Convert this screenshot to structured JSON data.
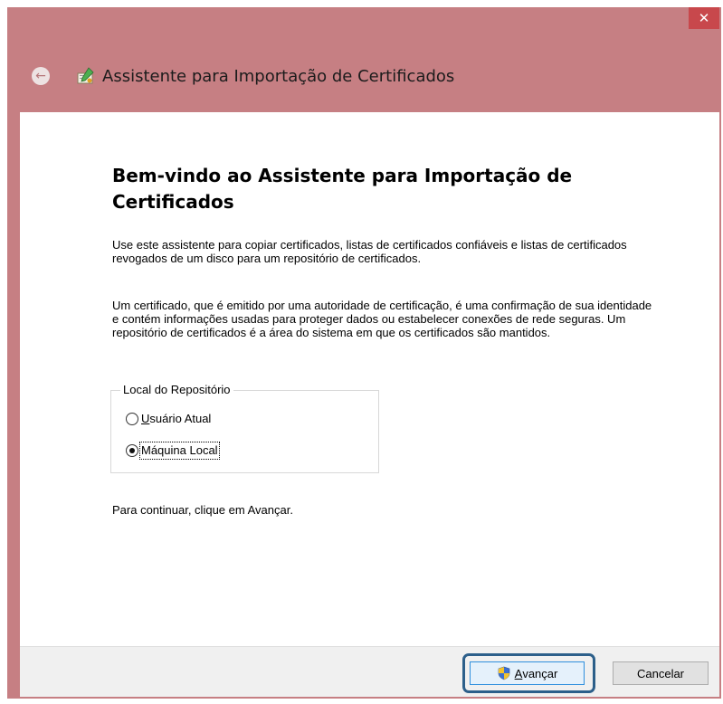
{
  "window": {
    "title": "Assistente para Importação de Certificados",
    "close_glyph": "✕",
    "back_glyph": "←",
    "title_icon": "certificate-wizard-icon",
    "titlebar_color": "#c67f83",
    "close_color": "#c8484c"
  },
  "wizard": {
    "heading": "Bem-vindo ao Assistente para Importação de Certificados",
    "intro": "Use este assistente para copiar certificados, listas de certificados confiáveis e listas de certificados revogados de um disco para um repositório de certificados.",
    "description": "Um certificado, que é emitido por uma autoridade de certificação, é uma confirmação de sua identidade e contém informações usadas para proteger dados ou estabelecer conexões de rede seguras. Um repositório de certificados é a área do sistema em que os certificados são mantidos.",
    "store_group": {
      "legend": "Local do Repositório",
      "options": [
        {
          "accel": "U",
          "rest": "suário Atual",
          "checked": false
        },
        {
          "accel": "",
          "rest": "Máquina Local",
          "checked": true
        }
      ]
    },
    "continue_hint": "Para continuar, clique em Avançar."
  },
  "buttons": {
    "next_accel": "A",
    "next_rest": "vançar",
    "next_icon": "uac-shield-icon",
    "cancel": "Cancelar",
    "highlight_color": "#2c5f8a"
  }
}
